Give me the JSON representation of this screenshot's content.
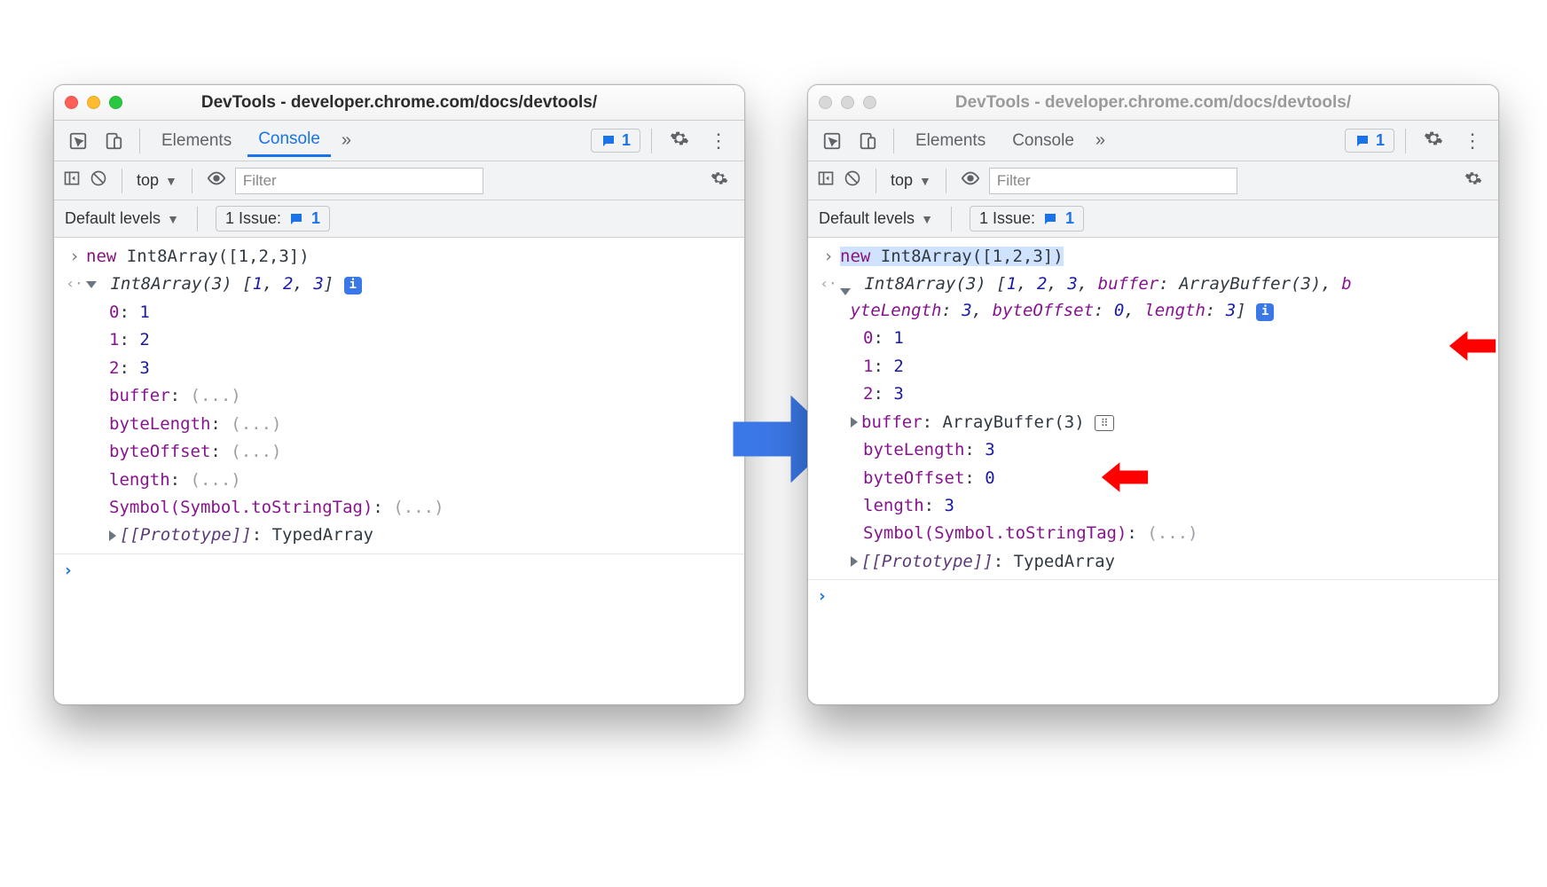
{
  "window": {
    "title": "DevTools - developer.chrome.com/docs/devtools/"
  },
  "toolbar": {
    "tab_elements": "Elements",
    "tab_console": "Console",
    "issue_count": "1"
  },
  "subbar": {
    "context": "top",
    "filter_placeholder": "Filter"
  },
  "levels": {
    "default_levels": "Default levels",
    "issue_label": "1 Issue:",
    "issue_count": "1"
  },
  "input": {
    "kw_new": "new",
    "expr_rest": " Int8Array([1,2,3])"
  },
  "left": {
    "summary_prefix": "Int8Array(3) ",
    "summary_open": "[",
    "v1": "1",
    "v2": "2",
    "v3": "3",
    "summary_close": "]",
    "p0k": "0",
    "p0v": "1",
    "p1k": "1",
    "p1v": "2",
    "p2k": "2",
    "p2v": "3",
    "buffer_k": "buffer",
    "ellipsis": "(...)",
    "byteLength_k": "byteLength",
    "byteOffset_k": "byteOffset",
    "length_k": "length",
    "symbol_k": "Symbol(Symbol.toStringTag)",
    "proto_k": "[[Prototype]]",
    "proto_v": "TypedArray"
  },
  "right": {
    "summary_prefix": "Int8Array(3) ",
    "summary_open": "[",
    "v1": "1",
    "v2": "2",
    "v3": "3",
    "buf_k": "buffer",
    "buf_v_type": "ArrayBuffer(3)",
    "wrap_tail": "b",
    "line2_a_k": "yteLength",
    "line2_a_v": "3",
    "line2_b_k": "byteOffset",
    "line2_b_v": "0",
    "line2_c_k": "length",
    "line2_c_v": "3",
    "summary_close": "]",
    "p0k": "0",
    "p0v": "1",
    "p1k": "1",
    "p1v": "2",
    "p2k": "2",
    "p2v": "3",
    "buffer_row_k": "buffer",
    "buffer_row_v": "ArrayBuffer(3)",
    "byteLength_k": "byteLength",
    "byteLength_v": "3",
    "byteOffset_k": "byteOffset",
    "byteOffset_v": "0",
    "length_k": "length",
    "length_v": "3",
    "symbol_k": "Symbol(Symbol.toStringTag)",
    "symbol_v": "(...)",
    "proto_k": "[[Prototype]]",
    "proto_v": "TypedArray"
  }
}
